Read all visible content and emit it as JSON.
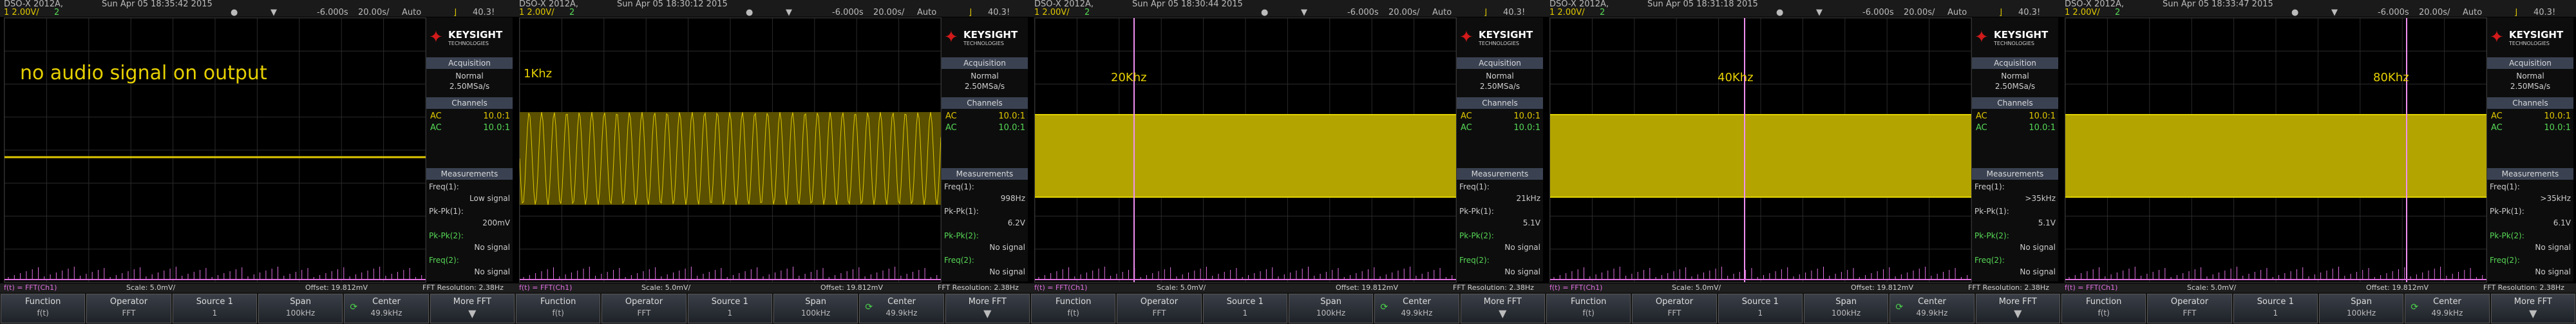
{
  "common": {
    "model": "DSO-X 2012A,",
    "ch1_scale": "1",
    "ch1_val": "2.00V/",
    "ch2_scale": "2",
    "ch2_val": "",
    "run_icon": "run-stop-icon",
    "cursor_icon": "cursor-icon",
    "time_delay": "-6.000s",
    "time_div": "20.00s/",
    "trig_mode": "Auto",
    "trig_icon": "trigger-icon",
    "trig_val": "40.3!",
    "logo_mark": "♣",
    "logo_name": "KEYSIGHT",
    "logo_sub": "TECHNOLOGIES",
    "acq_header": "Acquisition",
    "acq_mode": "Normal",
    "acq_rate": "2.50MSa/s",
    "channels_header": "Channels",
    "ch_rows": [
      {
        "k": "AC",
        "v": "10.0:1"
      },
      {
        "k": "AC",
        "v": "10.0:1"
      }
    ],
    "meas_header": "Measurements",
    "meas_freq1": "Freq(1):",
    "meas_pk1": "Pk-Pk(1):",
    "meas_pk2": "Pk-Pk(2):",
    "meas_freq2": "Freq(2):",
    "fft_line": "f(t) = FFT(Ch1)",
    "fft_scale": "Scale: 5.0mV/",
    "fft_offset": "Offset: 19.812mV",
    "fft_res": "FFT Resolution: 2.38Hz",
    "softkeys": [
      {
        "t": "Function",
        "v": "f(t)"
      },
      {
        "t": "Operator",
        "v": "FFT"
      },
      {
        "t": "Source 1",
        "v": "1"
      },
      {
        "t": "Span",
        "v": "100kHz"
      },
      {
        "t": "Center",
        "v": "49.9kHz"
      },
      {
        "t": "More FFT",
        "v": ""
      }
    ],
    "colors": {
      "ch1": "#e0c800",
      "ch2": "#56d856",
      "fft": "#e070e0",
      "grid": "#333333"
    }
  },
  "scopes": [
    {
      "timestamp": "Sun Apr 05 18:35:42 2015",
      "annotation": "no audio signal on output",
      "signal": "none",
      "freq1": "Low signal",
      "pk1": "200mV",
      "pk2": "No signal",
      "freq2": "No signal"
    },
    {
      "timestamp": "Sun Apr 05 18:30:12 2015",
      "annotation": "1Khz",
      "signal": "sine",
      "freq1": "998Hz",
      "pk1": "6.2V",
      "pk2": "No signal",
      "freq2": "No signal"
    },
    {
      "timestamp": "Sun Apr 05 18:30:44 2015",
      "annotation": "20Khz",
      "signal": "dense",
      "freq1": "21kHz",
      "pk1": "5.1V",
      "pk2": "No signal",
      "freq2": "No signal"
    },
    {
      "timestamp": "Sun Apr 05 18:31:18 2015",
      "annotation": "40Khz",
      "signal": "dense",
      "freq1": ">35kHz",
      "pk1": "5.1V",
      "pk2": "No signal",
      "freq2": "No signal"
    },
    {
      "timestamp": "Sun Apr 05 18:33:47 2015",
      "annotation": "80Khz",
      "signal": "dense",
      "freq1": ">35kHz",
      "pk1": "6.1V",
      "pk2": "No signal",
      "freq2": "No signal"
    }
  ]
}
